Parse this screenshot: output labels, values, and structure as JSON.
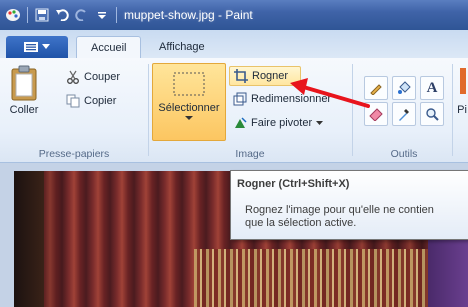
{
  "window": {
    "title": "muppet-show.jpg - Paint"
  },
  "tabs": [
    {
      "label": "Accueil",
      "active": true
    },
    {
      "label": "Affichage",
      "active": false
    }
  ],
  "clipboard": {
    "paste_label": "Coller",
    "cut_label": "Couper",
    "copy_label": "Copier",
    "group_label": "Presse-papiers"
  },
  "image": {
    "select_label": "Sélectionner",
    "crop_label": "Rogner",
    "resize_label": "Redimensionner",
    "rotate_label": "Faire pivoter",
    "group_label": "Image"
  },
  "tools": {
    "group_label": "Outils"
  },
  "partial": {
    "next_label": "Pi"
  },
  "tooltip": {
    "title": "Rogner (Ctrl+Shift+X)",
    "line1": "Rognez l'image pour qu'elle ne contien",
    "line2": "que la sélection active."
  },
  "colors": {
    "arrow": "#e8141c",
    "accent": "#2f5596"
  }
}
